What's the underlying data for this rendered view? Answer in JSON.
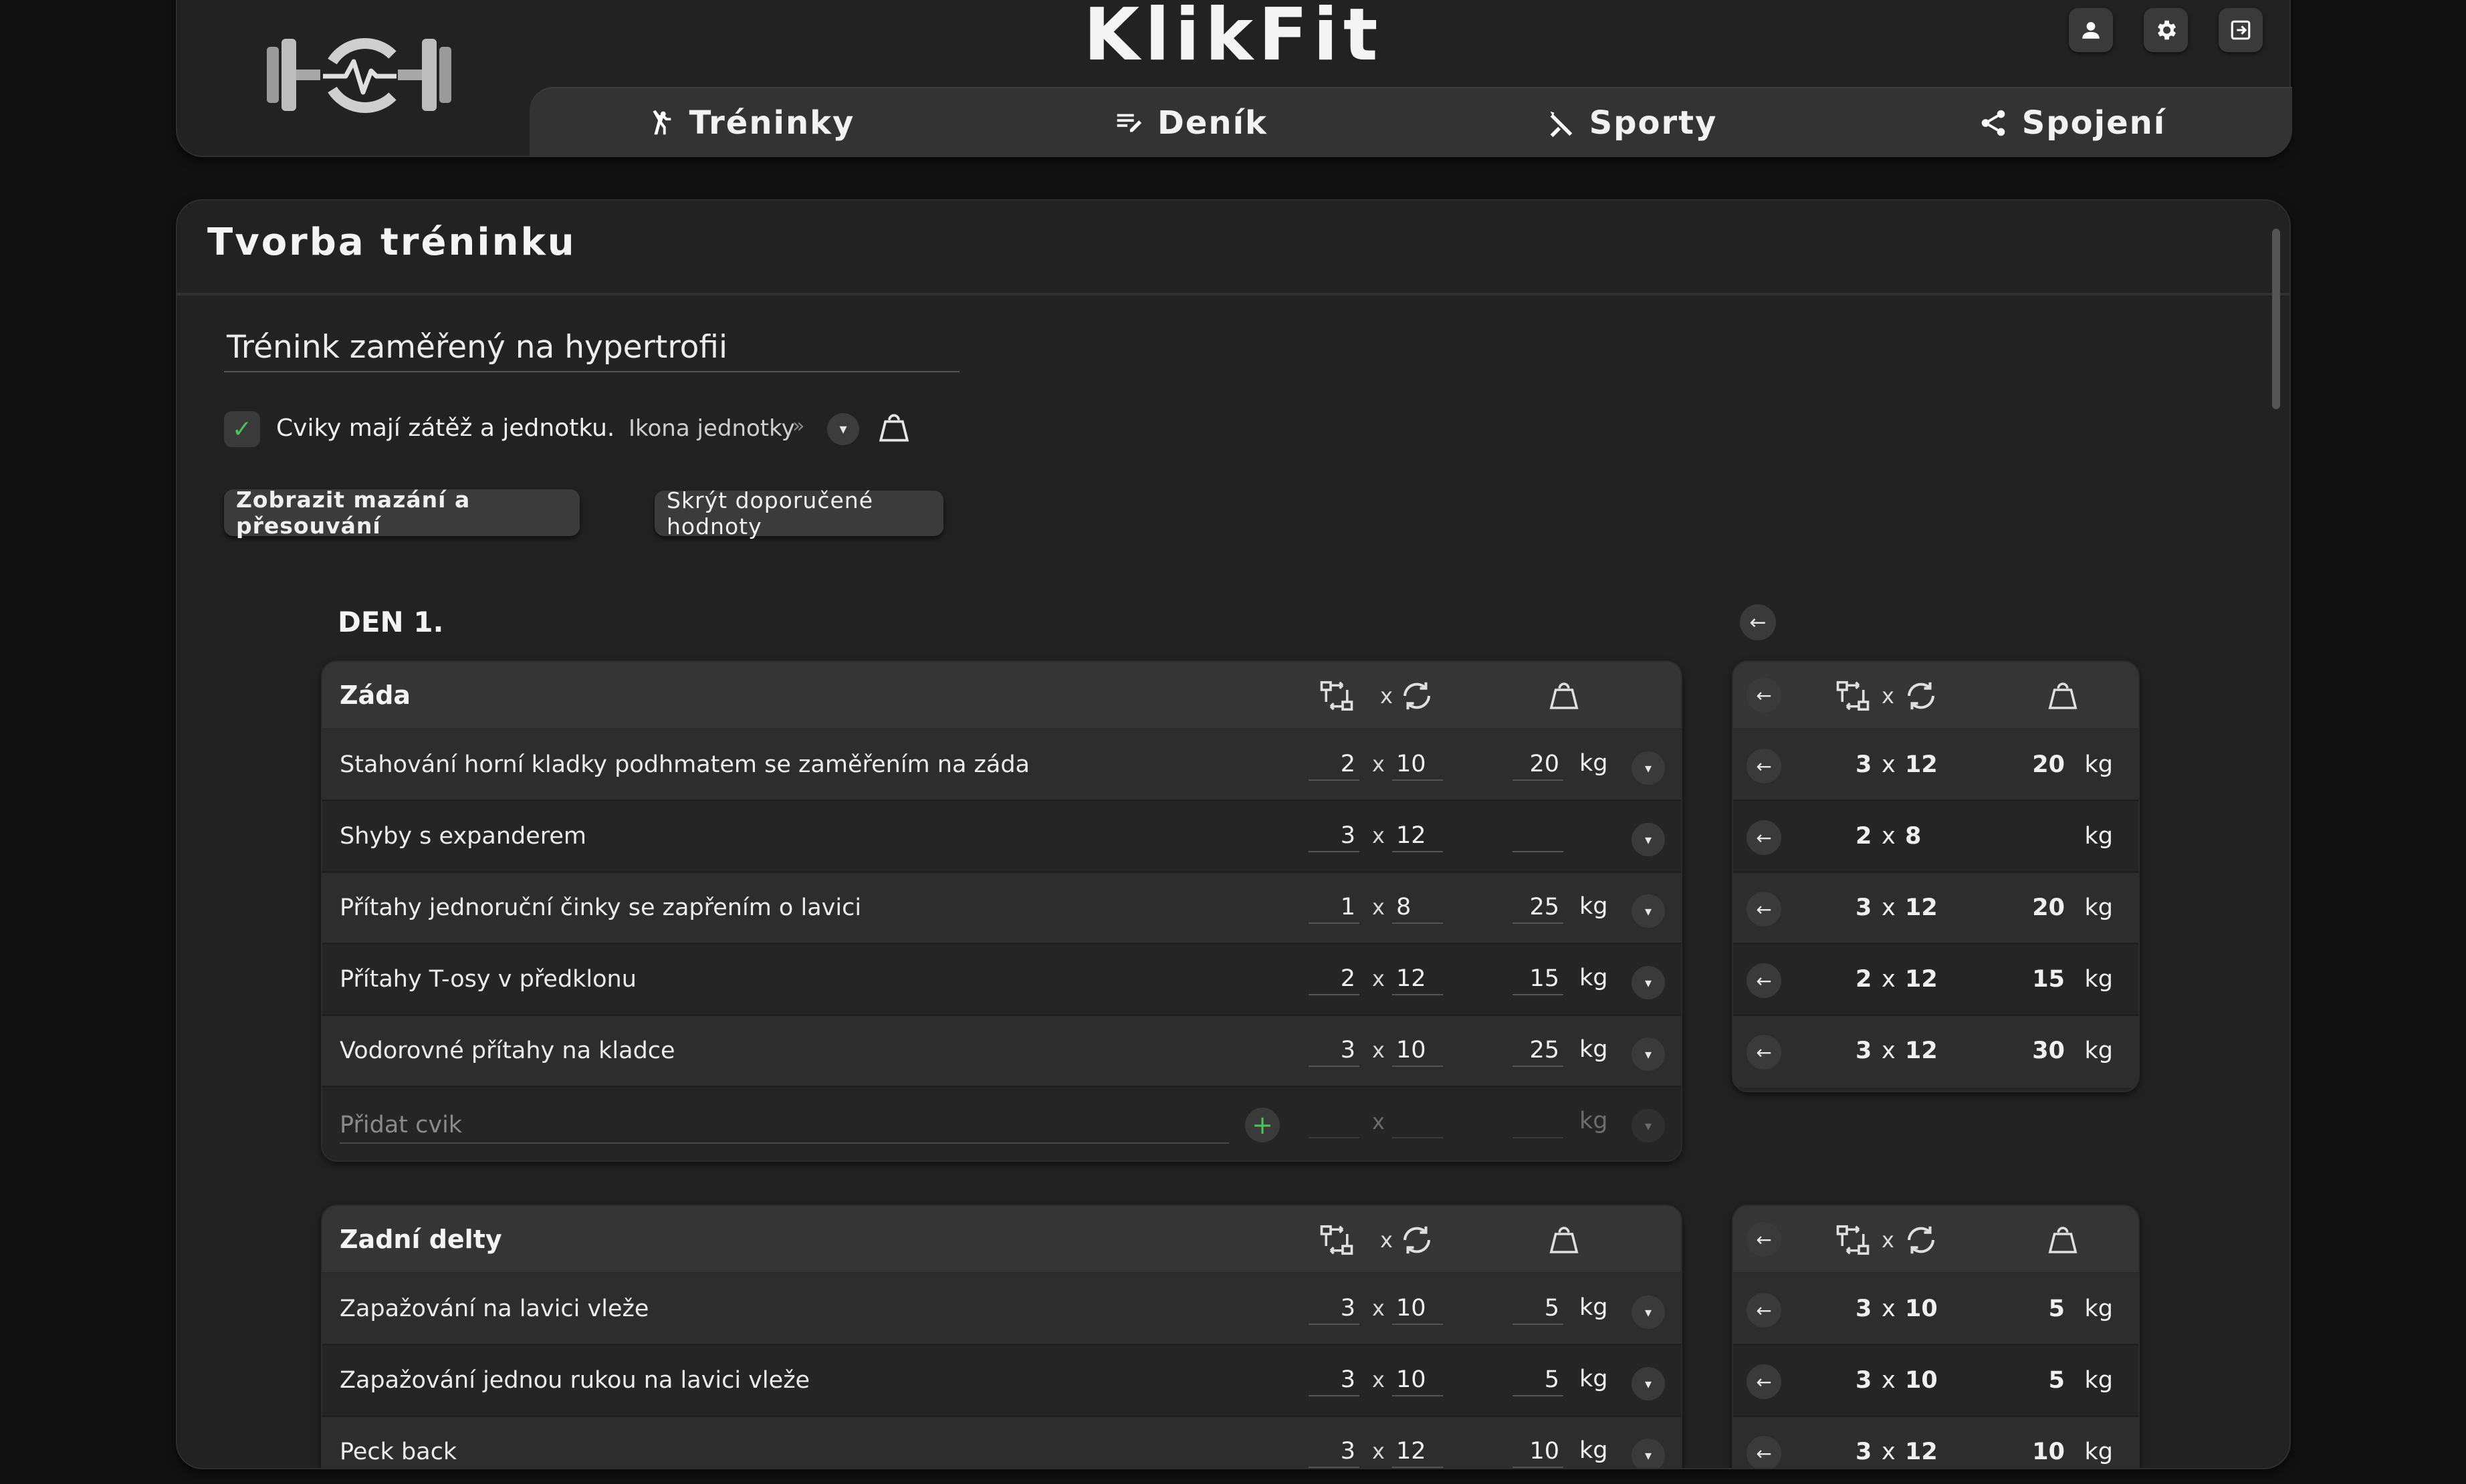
{
  "app": {
    "brand": "KlikFit"
  },
  "nav": [
    {
      "label": "Tréninky",
      "icon": "exercise-icon"
    },
    {
      "label": "Deník",
      "icon": "edit-list-icon"
    },
    {
      "label": "Sporty",
      "icon": "sport-icon"
    },
    {
      "label": "Spojení",
      "icon": "share-icon"
    }
  ],
  "page": {
    "title": "Tvorba tréninku",
    "training_name": "Trénink zaměřený na hypertrofii",
    "checkbox_label": "Cviky mají zátěž a jednotku.",
    "checkbox_checked": true,
    "unit_icon_label": "Ikona jednotky",
    "unit_icon_chevron": "»",
    "btn_show_delete": "Zobrazit mazání a přesouvání",
    "btn_hide_recommended": "Skrýt doporučené hodnoty",
    "day_label": "DEN 1."
  },
  "symbols": {
    "x": "x",
    "kg": "kg",
    "check": "✓",
    "plus": "+",
    "back": "←",
    "dropdown": "▾"
  },
  "groups": [
    {
      "title": "Záda",
      "exercises": [
        {
          "name": "Stahování horní kladky podhmatem se zaměřením na záda",
          "sets": "2",
          "reps": "10",
          "weight": "20",
          "unit": "kg"
        },
        {
          "name": "Shyby s expanderem",
          "sets": "3",
          "reps": "12",
          "weight": "",
          "unit": ""
        },
        {
          "name": "Přítahy jednoruční činky se zapřením o lavici",
          "sets": "1",
          "reps": "8",
          "weight": "25",
          "unit": "kg"
        },
        {
          "name": "Přítahy T-osy v předklonu",
          "sets": "2",
          "reps": "12",
          "weight": "15",
          "unit": "kg"
        },
        {
          "name": "Vodorovné přítahy na kladce",
          "sets": "3",
          "reps": "10",
          "weight": "25",
          "unit": "kg"
        }
      ],
      "add_placeholder": "Přidat cvik",
      "recommended": [
        {
          "sets": "3",
          "reps": "12",
          "weight": "20",
          "unit": "kg"
        },
        {
          "sets": "2",
          "reps": "8",
          "weight": "",
          "unit": "kg"
        },
        {
          "sets": "3",
          "reps": "12",
          "weight": "20",
          "unit": "kg"
        },
        {
          "sets": "2",
          "reps": "12",
          "weight": "15",
          "unit": "kg"
        },
        {
          "sets": "3",
          "reps": "12",
          "weight": "30",
          "unit": "kg"
        }
      ]
    },
    {
      "title": "Zadní delty",
      "exercises": [
        {
          "name": "Zapažování na lavici vleže",
          "sets": "3",
          "reps": "10",
          "weight": "5",
          "unit": "kg"
        },
        {
          "name": "Zapažování jednou rukou na lavici vleže",
          "sets": "3",
          "reps": "10",
          "weight": "5",
          "unit": "kg"
        },
        {
          "name": "Peck back",
          "sets": "3",
          "reps": "12",
          "weight": "10",
          "unit": "kg"
        }
      ],
      "recommended": [
        {
          "sets": "3",
          "reps": "10",
          "weight": "5",
          "unit": "kg"
        },
        {
          "sets": "3",
          "reps": "10",
          "weight": "5",
          "unit": "kg"
        },
        {
          "sets": "3",
          "reps": "12",
          "weight": "10",
          "unit": "kg"
        }
      ]
    }
  ]
}
